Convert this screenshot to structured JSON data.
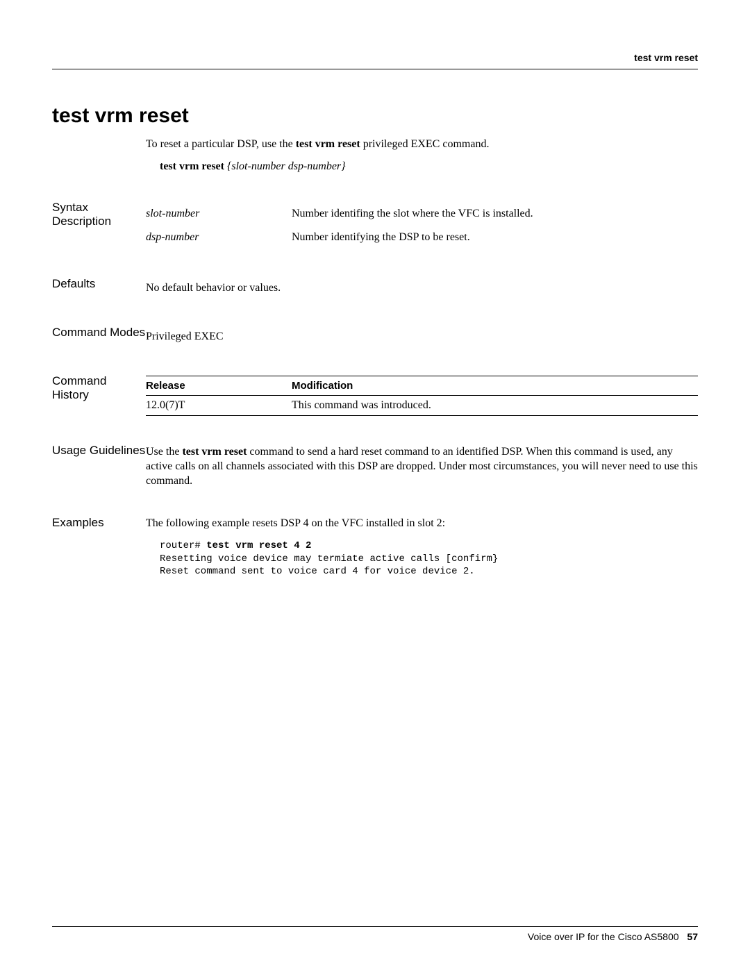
{
  "header": {
    "label": "test vrm reset"
  },
  "title": "test vrm reset",
  "intro": {
    "prefix": "To reset a particular DSP, use the ",
    "bold_cmd": "test vrm reset",
    "suffix": " privileged EXEC command."
  },
  "syntax_line": {
    "cmd": "test vrm reset",
    "args": " {slot-number dsp-number}"
  },
  "sections": {
    "syntax_description": {
      "heading": "Syntax Description",
      "rows": [
        {
          "param": "slot-number",
          "desc": "Number identifing the slot where the VFC is installed."
        },
        {
          "param": "dsp-number",
          "desc": "Number identifying the DSP to be reset."
        }
      ]
    },
    "defaults": {
      "heading": "Defaults",
      "text": "No default behavior or values."
    },
    "command_modes": {
      "heading": "Command Modes",
      "text": "Privileged EXEC"
    },
    "command_history": {
      "heading": "Command History",
      "col1": "Release",
      "col2": "Modification",
      "rows": [
        {
          "release": "12.0(7)T",
          "modification": "This command was introduced."
        }
      ]
    },
    "usage_guidelines": {
      "heading": "Usage Guidelines",
      "prefix": "Use the ",
      "bold_cmd": "test vrm reset",
      "suffix": " command to send a hard reset command to an identified DSP. When this command is used, any active calls on all channels associated with this DSP are dropped. Under most circumstances, you will never need to use this command."
    },
    "examples": {
      "heading": "Examples",
      "intro": "The following example resets DSP 4 on the VFC installed in slot 2:",
      "code_prompt": "router# ",
      "code_cmd": "test vrm reset 4 2",
      "code_output": "Resetting voice device may termiate active calls [confirm}\nReset command sent to voice card 4 for voice device 2."
    }
  },
  "footer": {
    "doc_title": "Voice over IP for the Cisco AS5800",
    "page": "57"
  }
}
